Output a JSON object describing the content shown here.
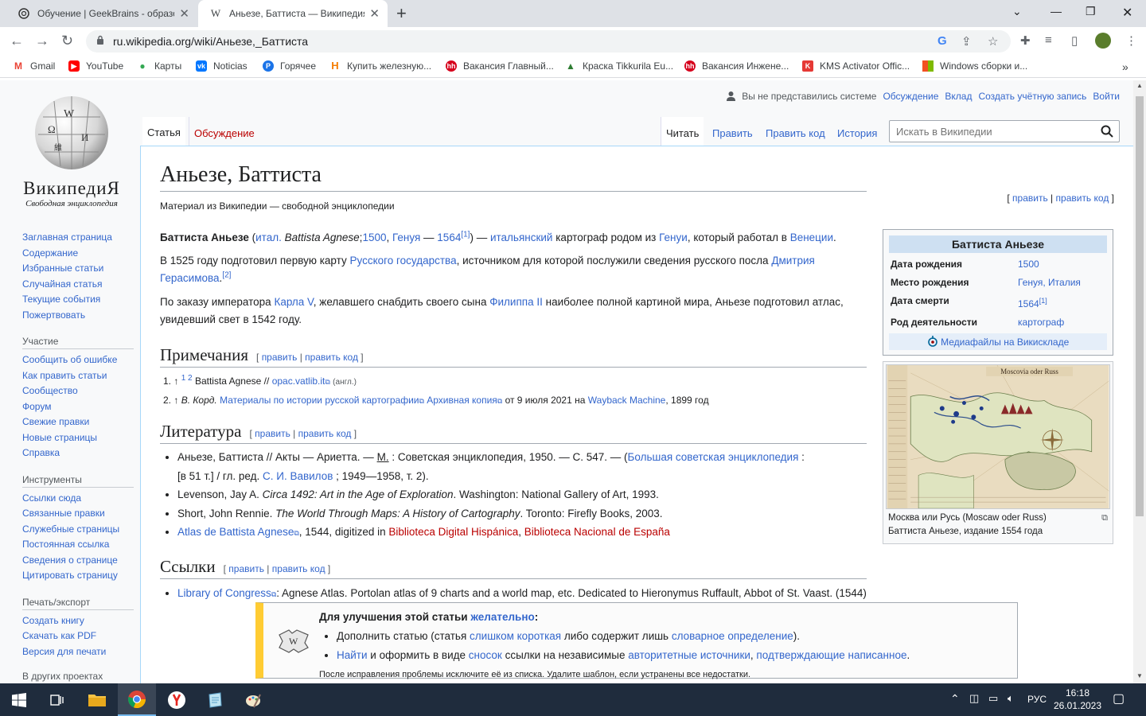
{
  "browser": {
    "tabs": [
      {
        "title": "Обучение | GeekBrains - образо",
        "active": false
      },
      {
        "title": "Аньезе, Баттиста — Википедия",
        "active": true
      }
    ],
    "url": "ru.wikipedia.org/wiki/Аньезе,_Баттиста",
    "bookmarks": [
      "Gmail",
      "YouTube",
      "Карты",
      "Noticias",
      "Горячее",
      "Купить железную...",
      "Вакансия Главный...",
      "Краска Tikkurila Eu...",
      "Вакансия Инжене...",
      "KMS Activator Offic...",
      "Windows сборки и..."
    ]
  },
  "wiki": {
    "wordmark": "ВикипедиЯ",
    "tagline": "Свободная энциклопедия",
    "personal": {
      "anon": "Вы не представились системе",
      "links": [
        "Обсуждение",
        "Вклад",
        "Создать учётную запись",
        "Войти"
      ]
    },
    "tabs": {
      "article": "Статья",
      "talk": "Обсуждение",
      "read": "Читать",
      "edit": "Править",
      "editsource": "Править код",
      "history": "История"
    },
    "search_placeholder": "Искать в Википедии",
    "sidebar": {
      "nav": [
        "Заглавная страница",
        "Содержание",
        "Избранные статьи",
        "Случайная статья",
        "Текущие события",
        "Пожертвовать"
      ],
      "participation_title": "Участие",
      "participation": [
        "Сообщить об ошибке",
        "Как править статьи",
        "Сообщество",
        "Форум",
        "Свежие правки",
        "Новые страницы",
        "Справка"
      ],
      "tools_title": "Инструменты",
      "tools": [
        "Ссылки сюда",
        "Связанные правки",
        "Служебные страницы",
        "Постоянная ссылка",
        "Сведения о странице",
        "Цитировать страницу"
      ],
      "print_title": "Печать/экспорт",
      "print": [
        "Создать книгу",
        "Скачать как PDF",
        "Версия для печати"
      ],
      "other_title": "В других проектах"
    }
  },
  "article": {
    "title": "Аньезе, Баттиста",
    "site_sub": "Материал из Википедии — свободной энциклопедии",
    "top_edit": [
      "править",
      "править код"
    ],
    "p1": {
      "name": "Баттиста Аньезе",
      "lang": "итал.",
      "latin": "Battista Agnese",
      "born": "1500",
      "place": "Генуя",
      "died": "1564",
      "ref": "[1]",
      "nationality": "итальянский",
      "text1": "картограф родом из",
      "city1": "Генуи",
      "text2": ", который работал в",
      "city2": "Венеции"
    },
    "p2": {
      "t1": "В 1525 году подготовил первую карту",
      "link1": "Русского государства",
      "t2": ", источником для которой послужили сведения русского посла",
      "link2": "Дмитрия Герасимова",
      "ref": "[2]"
    },
    "p3": {
      "t1": "По заказу императора",
      "link1": "Карла V",
      "t2": ", желавшего снабдить своего сына",
      "link2": "Филиппа II",
      "t3": "наиболее полной картиной мира, Аньезе подготовил атлас, увидевший свет в 1542 году."
    },
    "sections": {
      "notes": "Примечания",
      "lit": "Литература",
      "links": "Ссылки",
      "edit": "править",
      "editsource": "править код"
    },
    "notes": [
      {
        "n": "1.",
        "text": "Battista Agnese //",
        "link": "opac.vatlib.it",
        "lang": "(англ.)"
      },
      {
        "n": "2.",
        "author": "В. Корд.",
        "link": "Материалы по истории русской картографии",
        "archive": "Архивная копия",
        "tail1": "от 9 июля 2021 на",
        "wayback": "Wayback Machine",
        "tail2": ", 1899 год"
      }
    ],
    "literature": {
      "l1a": "Аньезе, Баттиста // Акты — Ариетта. —",
      "l1m": "М.",
      "l1b": ": Советская энциклопедия, 1950. — С. 547. — (",
      "l1link": "Большая советская энциклопедия",
      "l1c": ":",
      "l1d": "[в 51 т.] / гл. ред.",
      "l1editor": "С. И. Вавилов",
      "l1e": "; 1949—1958, т. 2).",
      "l2a": "Levenson, Jay A.",
      "l2i": "Circa 1492: Art in the Age of Exploration",
      "l2b": ". Washington: National Gallery of Art, 1993.",
      "l3a": "Short, John Rennie.",
      "l3i": "The World Through Maps: A History of Cartography",
      "l3b": ". Toronto: Firefly Books, 2003.",
      "l4link": "Atlas de Battista Agnese",
      "l4a": ", 1544, digitized in",
      "l4red1": "Biblioteca Digital Hispánica",
      "l4red2": "Biblioteca Nacional de España"
    },
    "links_list": {
      "link": "Library of Congress",
      "text": ": Agnese Atlas. Portolan atlas of 9 charts and a world map, etc. Dedicated to Hieronymus Ruffault, Abbot of St. Vaast. (1544)"
    },
    "infobox": {
      "title": "Баттиста Аньезе",
      "rows": [
        {
          "k": "Дата рождения",
          "v": "1500"
        },
        {
          "k": "Место рождения",
          "v": "Генуя, Италия"
        },
        {
          "k": "Дата смерти",
          "v": "1564",
          "ref": "[1]"
        },
        {
          "k": "Род деятельности",
          "v": "картограф"
        }
      ],
      "commons": "Медиафайлы на Викискладе"
    },
    "thumb": {
      "map_title": "Moscovia oder Russ",
      "caption1": "Москва или Русь (Moscaw oder Russ)",
      "caption2": "Баттиста Аньезе, издание 1554 года"
    },
    "ambox": {
      "head1": "Для улучшения этой статьи",
      "head_link": "желательно",
      "b1a": "Дополнить статью (статья",
      "b1link1": "слишком короткая",
      "b1b": "либо содержит лишь",
      "b1link2": "словарное определение",
      "b1c": ").",
      "b2link1": "Найти",
      "b2a": "и оформить в виде",
      "b2link2": "сносок",
      "b2b": "ссылки на независимые",
      "b2link3": "авторитетные источники",
      "b2link4": "подтверждающие написанное",
      "footer": "После исправления проблемы исключите её из списка. Удалите шаблон, если устранены все недостатки."
    }
  },
  "taskbar": {
    "lang": "РУС",
    "time": "16:18",
    "date": "26.01.2023"
  }
}
